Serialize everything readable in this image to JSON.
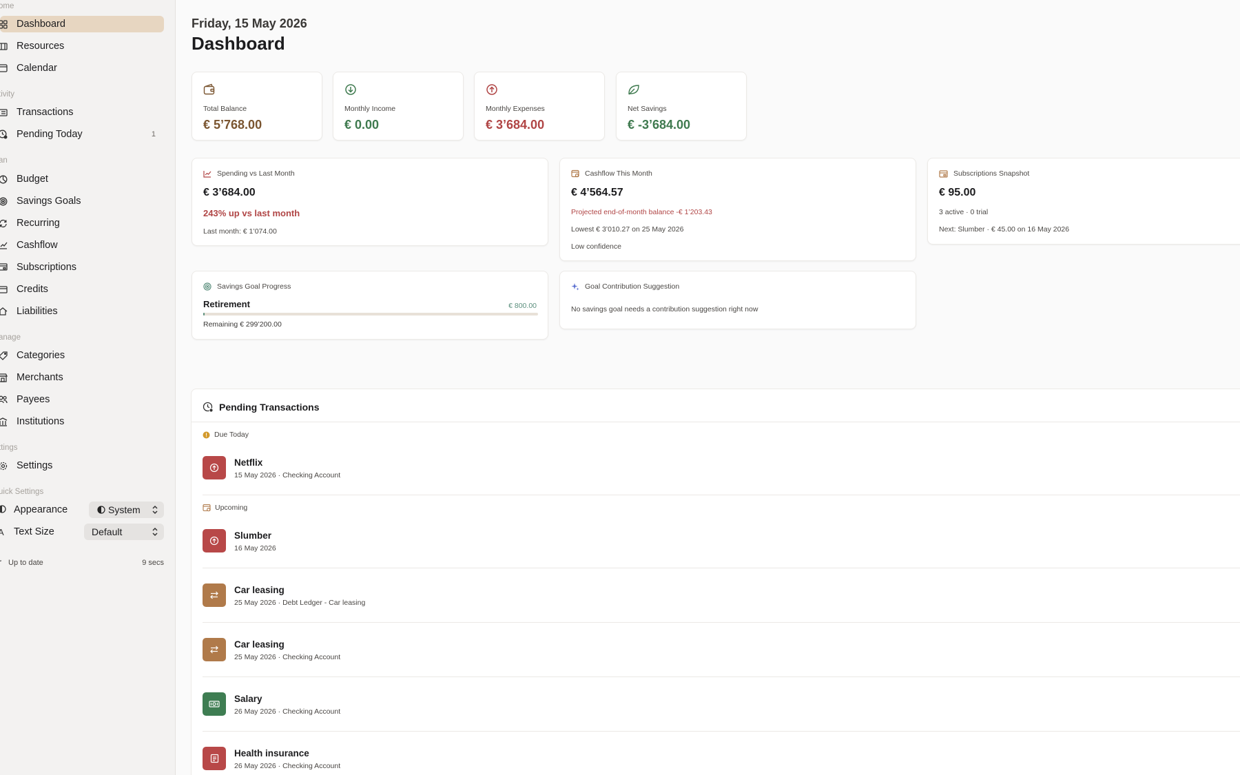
{
  "sidebar": {
    "sections": {
      "home": "ome",
      "activity": "tivity",
      "plan": "an",
      "manage": "anage",
      "settings": "ttings",
      "quick": "uick Settings"
    },
    "items": {
      "dashboard": "Dashboard",
      "resources": "Resources",
      "calendar": "Calendar",
      "transactions": "Transactions",
      "pending_today": "Pending Today",
      "pending_today_count": "1",
      "budget": "Budget",
      "savings_goals": "Savings Goals",
      "recurring": "Recurring",
      "cashflow": "Cashflow",
      "subscriptions": "Subscriptions",
      "credits": "Credits",
      "liabilities": "Liabilities",
      "categories": "Categories",
      "merchants": "Merchants",
      "payees": "Payees",
      "institutions": "Institutions",
      "settings": "Settings"
    },
    "quick_settings": {
      "appearance_label": "Appearance",
      "appearance_value": "System",
      "text_size_icon": "A",
      "text_size_label": "Text Size",
      "text_size_value": "Default"
    },
    "status": {
      "label": "Up to date",
      "time": "9 secs"
    }
  },
  "header": {
    "date": "Friday, 15 May 2026",
    "title": "Dashboard"
  },
  "stats": [
    {
      "icon": "wallet-icon",
      "label": "Total Balance",
      "value": "€ 5’768.00",
      "color": "#7a5530"
    },
    {
      "icon": "arrow-down-circle-icon",
      "label": "Monthly Income",
      "value": "€ 0.00",
      "color": "#3f7a4f"
    },
    {
      "icon": "arrow-up-circle-icon",
      "label": "Monthly Expenses",
      "value": "€ 3’684.00",
      "color": "#b04545"
    },
    {
      "icon": "leaf-icon",
      "label": "Net Savings",
      "value": "€ -3’684.00",
      "color": "#3f7a4f"
    }
  ],
  "spending": {
    "title": "Spending vs Last Month",
    "value": "€ 3’684.00",
    "change": "243% up vs last month",
    "last_month": "Last month: € 1’074.00"
  },
  "cashflow": {
    "title": "Cashflow This Month",
    "value": "€ 4’564.57",
    "projected": "Projected end-of-month balance -€ 1’203.43",
    "lowest": "Lowest € 3’010.27 on 25 May 2026",
    "confidence": "Low confidence"
  },
  "subscriptions": {
    "title": "Subscriptions Snapshot",
    "value": "€ 95.00",
    "counts": "3 active · 0 trial",
    "next": "Next: Slumber · € 45.00 on 16 May 2026"
  },
  "savings_goal": {
    "title": "Savings Goal Progress",
    "goal": "Retirement",
    "amount": "€ 800.00",
    "progress": 0.0027,
    "remaining": "Remaining € 299’200.00"
  },
  "goal_suggestion": {
    "title": "Goal Contribution Suggestion",
    "message": "No savings goal needs a contribution suggestion right now"
  },
  "pending": {
    "title": "Pending Transactions",
    "due_today_label": "Due Today",
    "upcoming_label": "Upcoming",
    "due_today": [
      {
        "name": "Netflix",
        "date": "15 May 2026",
        "account": "Checking Account",
        "icon": "arrow-up-circle-icon",
        "color": "#b84848"
      }
    ],
    "upcoming": [
      {
        "name": "Slumber",
        "date": "16 May 2026",
        "account": "",
        "icon": "arrow-up-circle-icon",
        "color": "#b84848"
      },
      {
        "name": "Car leasing",
        "date": "25 May 2026",
        "account": "Debt Ledger - Car leasing",
        "icon": "transfer-icon",
        "color": "#b07a4a"
      },
      {
        "name": "Car leasing",
        "date": "25 May 2026",
        "account": "Checking Account",
        "icon": "transfer-icon",
        "color": "#b07a4a"
      },
      {
        "name": "Salary",
        "date": "26 May 2026",
        "account": "Checking Account",
        "icon": "banknote-icon",
        "color": "#3e7d52"
      },
      {
        "name": "Health insurance",
        "date": "26 May 2026",
        "account": "Checking Account",
        "icon": "document-icon",
        "color": "#b84848"
      }
    ]
  }
}
